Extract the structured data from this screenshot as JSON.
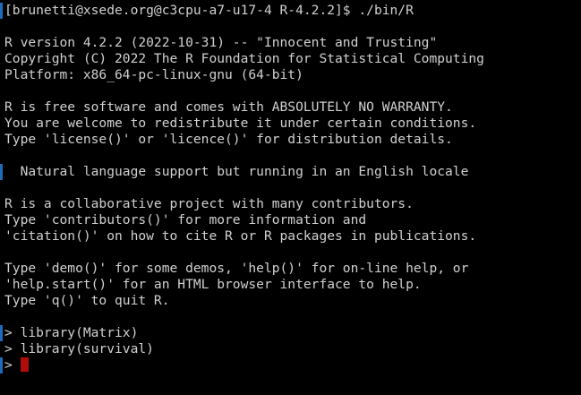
{
  "colors": {
    "background": "#000000",
    "text": "#d0d0d0",
    "cursor": "#b00d0d",
    "left_marker": "#1e6bb8"
  },
  "terminal": {
    "lines": [
      "[brunetti@xsede.org@c3cpu-a7-u17-4 R-4.2.2]$ ./bin/R",
      "",
      "R version 4.2.2 (2022-10-31) -- \"Innocent and Trusting\"",
      "Copyright (C) 2022 The R Foundation for Statistical Computing",
      "Platform: x86_64-pc-linux-gnu (64-bit)",
      "",
      "R is free software and comes with ABSOLUTELY NO WARRANTY.",
      "You are welcome to redistribute it under certain conditions.",
      "Type 'license()' or 'licence()' for distribution details.",
      "",
      "  Natural language support but running in an English locale",
      "",
      "R is a collaborative project with many contributors.",
      "Type 'contributors()' for more information and",
      "'citation()' on how to cite R or R packages in publications.",
      "",
      "Type 'demo()' for some demos, 'help()' for on-line help, or",
      "'help.start()' for an HTML browser interface to help.",
      "Type 'q()' to quit R.",
      "",
      "> library(Matrix)",
      "> library(survival)"
    ],
    "prompt": "> "
  }
}
